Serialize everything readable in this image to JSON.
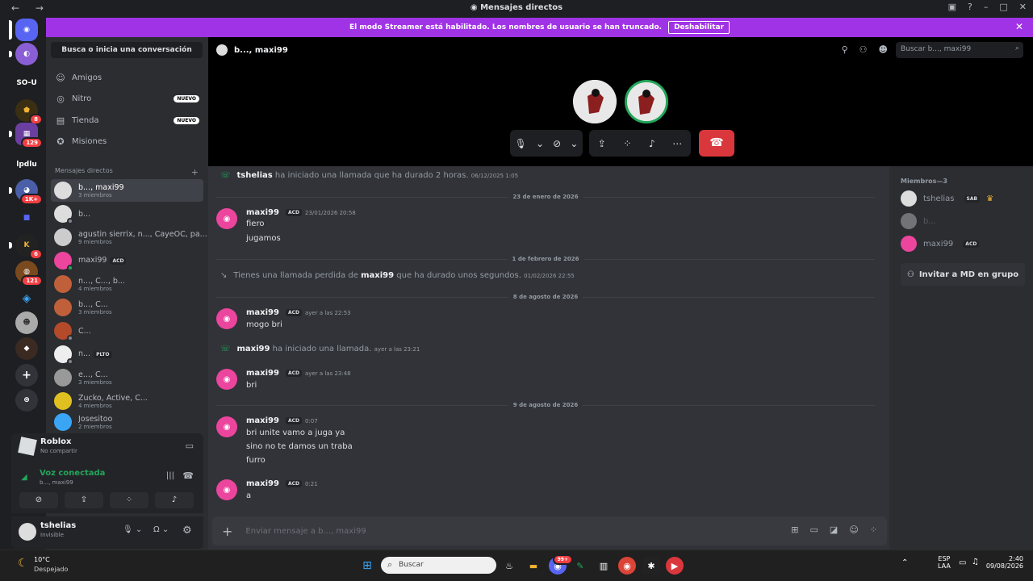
{
  "window": {
    "title": "Mensajes directos"
  },
  "banner": {
    "text": "El modo Streamer está habilitado. Los nombres de usuario se han truncado.",
    "button": "Deshabilitar"
  },
  "servers": [
    {
      "label": "SO-U"
    },
    {
      "label": "lpdlu"
    }
  ],
  "server_badges": [
    "8",
    "129",
    "1K+",
    "6",
    "121"
  ],
  "sidebar": {
    "search": "Busca o inicia una conversación",
    "nav": [
      {
        "label": "Amigos",
        "tag": ""
      },
      {
        "label": "Nitro",
        "tag": "NUEVO"
      },
      {
        "label": "Tienda",
        "tag": "NUEVO"
      },
      {
        "label": "Misiones",
        "tag": ""
      }
    ],
    "dm_header": "Mensajes directos",
    "dms": [
      {
        "name": "b..., maxi99",
        "sub": "3 miembros"
      },
      {
        "name": "b...",
        "sub": ""
      },
      {
        "name": "agustin sierrix, n..., CayeOC, pa...",
        "sub": "9 miembros"
      },
      {
        "name": "maxi99",
        "sub": "",
        "tag": "ACD"
      },
      {
        "name": "n..., C..., b...",
        "sub": "4 miembros"
      },
      {
        "name": "b..., C...",
        "sub": "3 miembros"
      },
      {
        "name": "C...",
        "sub": ""
      },
      {
        "name": "n...",
        "sub": "",
        "tag": "PLTO"
      },
      {
        "name": "e..., C...",
        "sub": "3 miembros"
      },
      {
        "name": "Zucko, Active, C...",
        "sub": "4 miembros"
      },
      {
        "name": "Josesitoo",
        "sub": "2 miembros"
      }
    ]
  },
  "activity": {
    "name": "Roblox",
    "sub": "No compartir"
  },
  "voice": {
    "status": "Voz conectada",
    "channel": "b..., maxi99"
  },
  "user": {
    "name": "tshelias",
    "status": "Invisible"
  },
  "header": {
    "title": "b..., maxi99",
    "search_placeholder": "Buscar b..., maxi99"
  },
  "chat": {
    "messages": [
      {
        "kind": "call",
        "author": "tshelias",
        "text": "ha iniciado una llamada que ha durado 2 horas.",
        "time": "06/12/2025 1:05"
      },
      {
        "kind": "divider",
        "text": "23 de enero de 2026"
      },
      {
        "kind": "msg",
        "author": "maxi99",
        "tag": "ACD",
        "time": "23/01/2026 20:58",
        "lines": [
          "fiero",
          "jugamos"
        ]
      },
      {
        "kind": "divider",
        "text": "1 de febrero de 2026"
      },
      {
        "kind": "missed",
        "pre": "Tienes una llamada perdida de",
        "author": "maxi99",
        "post": "que ha durado unos segundos.",
        "time": "01/02/2026 22:55"
      },
      {
        "kind": "divider",
        "text": "8 de agosto de 2026"
      },
      {
        "kind": "msg",
        "author": "maxi99",
        "tag": "ACD",
        "time": "ayer a las 22:53",
        "lines": [
          "mogo bri"
        ]
      },
      {
        "kind": "call",
        "author": "maxi99",
        "text": "ha iniciado una llamada.",
        "time": "ayer a las 23:21"
      },
      {
        "kind": "msg",
        "author": "maxi99",
        "tag": "ACD",
        "time": "ayer a las 23:48",
        "lines": [
          "bri"
        ]
      },
      {
        "kind": "divider",
        "text": "9 de agosto de 2026"
      },
      {
        "kind": "msg",
        "author": "maxi99",
        "tag": "ACD",
        "time": "0:07",
        "lines": [
          "bri unite vamo a juga ya",
          "sino no te damos un traba",
          "furro"
        ]
      },
      {
        "kind": "msg",
        "author": "maxi99",
        "tag": "ACD",
        "time": "0:21",
        "lines": [
          "a"
        ]
      }
    ]
  },
  "composer": {
    "placeholder": "Enviar mensaje a b..., maxi99"
  },
  "members": {
    "header": "Miembros—3",
    "list": [
      {
        "name": "tshelias",
        "tag": "SAB"
      },
      {
        "name": "b...",
        "tag": ""
      },
      {
        "name": "maxi99",
        "tag": "ACD"
      }
    ],
    "invite": "Invitar a MD en grupo"
  },
  "taskbar": {
    "weather_temp": "10°C",
    "weather_text": "Despejado",
    "search": "Buscar",
    "lang1": "ESP",
    "lang2": "LAA",
    "time": "2:40",
    "date": "09/08/2026",
    "notif": "99+"
  },
  "colors": {
    "accent": "#5865f2",
    "banner": "#a133e6",
    "online": "#23a55a",
    "danger": "#da373c",
    "mention": "#eb459e"
  }
}
